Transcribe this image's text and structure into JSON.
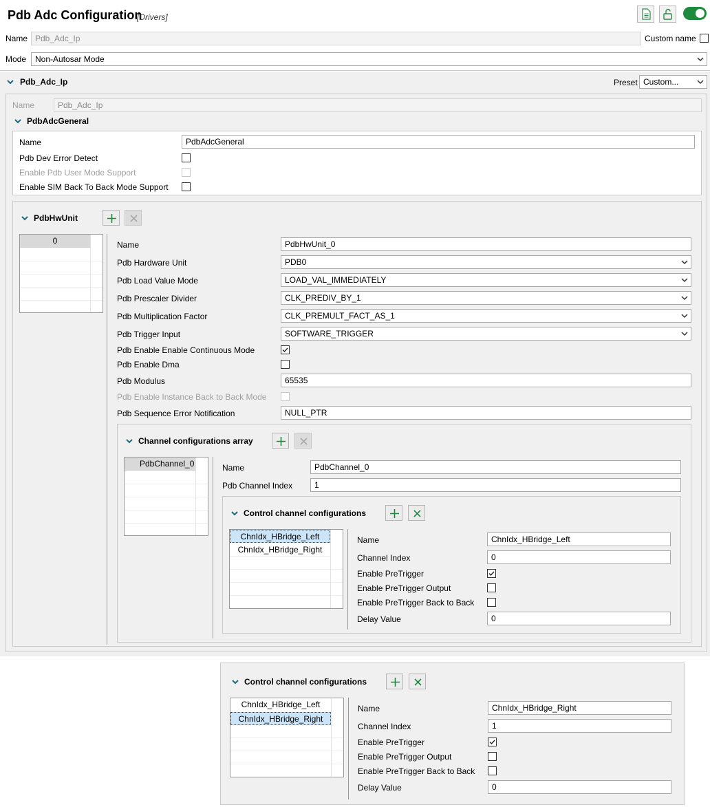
{
  "header": {
    "title": "Pdb Adc Configuration",
    "subtitle": "[Drivers]"
  },
  "top": {
    "name_label": "Name",
    "name_value": "Pdb_Adc_Ip",
    "custom_name_label": "Custom name",
    "mode_label": "Mode",
    "mode_value": "Non-Autosar Mode"
  },
  "ip": {
    "title": "Pdb_Adc_Ip",
    "preset_label": "Preset",
    "preset_value": "Custom...",
    "name_label": "Name",
    "name_value": "Pdb_Adc_Ip"
  },
  "general": {
    "title": "PdbAdcGeneral",
    "name_label": "Name",
    "name_value": "PdbAdcGeneral",
    "dev_error_label": "Pdb Dev Error Detect",
    "dev_error_checked": false,
    "user_mode_label": "Enable Pdb User Mode Support",
    "sim_b2b_label": "Enable SIM Back To Back Mode Support",
    "sim_b2b_checked": false
  },
  "hwunit": {
    "title": "PdbHwUnit",
    "list": [
      "0"
    ],
    "fields": {
      "name_label": "Name",
      "name_value": "PdbHwUnit_0",
      "hw_label": "Pdb Hardware Unit",
      "hw_value": "PDB0",
      "load_label": "Pdb Load Value Mode",
      "load_value": "LOAD_VAL_IMMEDIATELY",
      "prescaler_label": "Pdb Prescaler Divider",
      "prescaler_value": "CLK_PREDIV_BY_1",
      "mult_label": "Pdb Multiplication Factor",
      "mult_value": "CLK_PREMULT_FACT_AS_1",
      "trigger_label": "Pdb Trigger Input",
      "trigger_value": "SOFTWARE_TRIGGER",
      "cont_label": "Pdb Enable Enable Continuous Mode",
      "cont_checked": true,
      "dma_label": "Pdb Enable Dma",
      "dma_checked": false,
      "modulus_label": "Pdb Modulus",
      "modulus_value": "65535",
      "inst_b2b_label": "Pdb Enable Instance Back to Back Mode",
      "seq_err_label": "Pdb Sequence Error Notification",
      "seq_err_value": "NULL_PTR"
    }
  },
  "channels": {
    "title": "Channel configurations array",
    "list": [
      "PdbChannel_0"
    ],
    "name_label": "Name",
    "name_value": "PdbChannel_0",
    "index_label": "Pdb Channel Index",
    "index_value": "1"
  },
  "control": {
    "title": "Control channel configurations",
    "list": [
      "ChnIdx_HBridge_Left",
      "ChnIdx_HBridge_Right"
    ],
    "labels": {
      "name": "Name",
      "channel_index": "Channel Index",
      "pretrigger": "Enable PreTrigger",
      "pretrigger_output": "Enable PreTrigger Output",
      "pretrigger_b2b": "Enable PreTrigger Back to Back",
      "delay": "Delay Value"
    },
    "left": {
      "name": "ChnIdx_HBridge_Left",
      "channel_index": "0",
      "pretrigger": true,
      "pretrigger_output": false,
      "pretrigger_b2b": false,
      "delay": "0"
    },
    "right": {
      "name": "ChnIdx_HBridge_Right",
      "channel_index": "1",
      "pretrigger": true,
      "pretrigger_output": false,
      "pretrigger_b2b": false,
      "delay": "0"
    }
  },
  "icons": {
    "export": "document-icon",
    "lock": "unlock-icon",
    "toggle": "toggle-switch-icon"
  },
  "colors": {
    "accent": "#1e8a3c",
    "chevron": "#1a6b80",
    "selection": "#cce4f7"
  }
}
